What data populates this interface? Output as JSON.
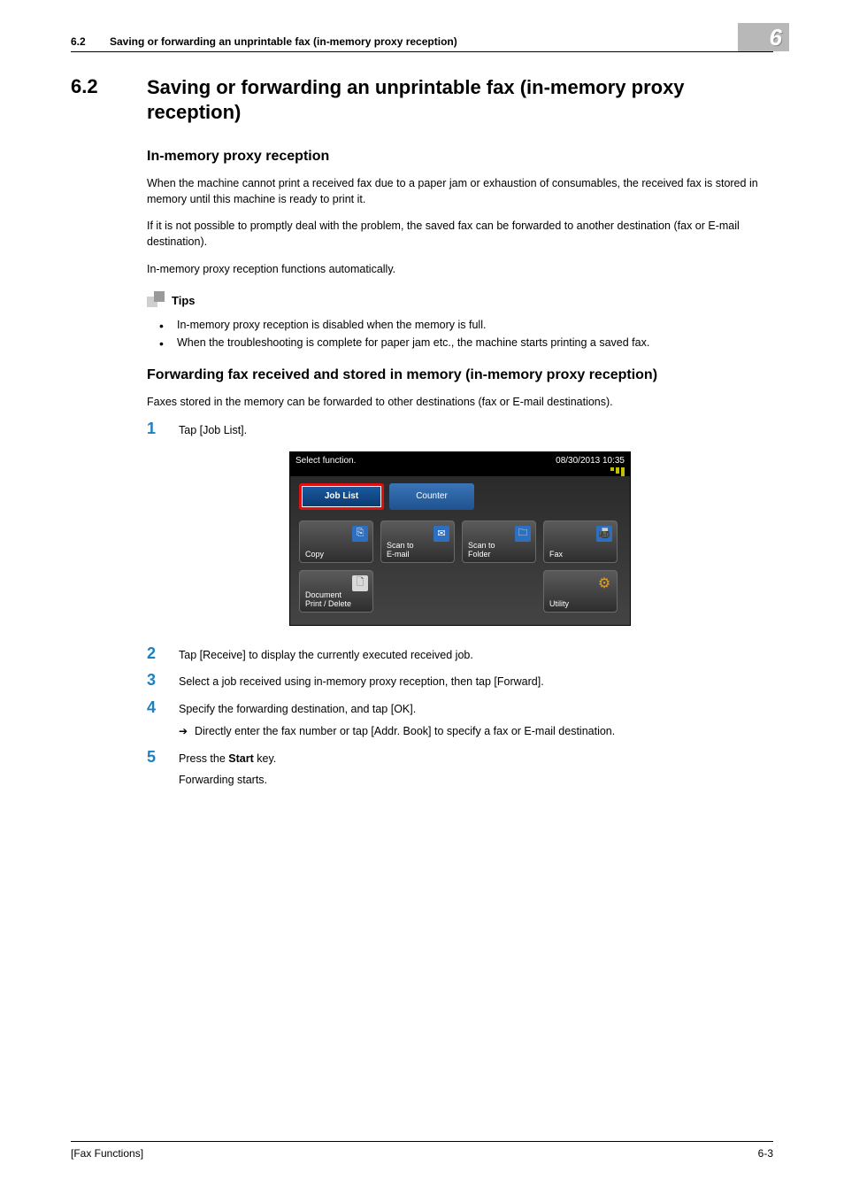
{
  "runhead": {
    "num": "6.2",
    "title": "Saving or forwarding an unprintable fax (in-memory proxy reception)"
  },
  "chapter_badge": "6",
  "h1": {
    "num": "6.2",
    "title": "Saving or forwarding an unprintable fax (in-memory proxy reception)"
  },
  "section1": {
    "heading": "In-memory proxy reception",
    "p1": "When the machine cannot print a received fax due to a paper jam or exhaustion of consumables, the received fax is stored in memory until this machine is ready to print it.",
    "p2": "If it is not possible to promptly deal with the problem, the saved fax can be forwarded to another destination (fax or E-mail destination).",
    "p3": "In-memory proxy reception functions automatically."
  },
  "tips": {
    "label": "Tips",
    "items": [
      "In-memory proxy reception is disabled when the memory is full.",
      "When the troubleshooting is complete for paper jam etc., the machine starts printing a saved fax."
    ]
  },
  "section2": {
    "heading": "Forwarding fax received and stored in memory (in-memory proxy reception)",
    "intro": "Faxes stored in the memory can be forwarded to other destinations (fax or E-mail destinations)."
  },
  "steps": [
    {
      "n": "1",
      "text": "Tap [Job List]."
    },
    {
      "n": "2",
      "text": "Tap [Receive] to display the currently executed received job."
    },
    {
      "n": "3",
      "text": "Select a job received using in-memory proxy reception, then tap [Forward]."
    },
    {
      "n": "4",
      "text": "Specify the forwarding destination, and tap [OK].",
      "sub": "Directly enter the fax number or tap [Addr. Book] to specify a fax or E-mail destination."
    },
    {
      "n": "5",
      "text_pre": "Press the ",
      "text_bold": "Start",
      "text_post": " key.",
      "tail": "Forwarding starts."
    }
  ],
  "screenshot": {
    "prompt": "Select function.",
    "datetime": "08/30/2013 10:35",
    "tabs": {
      "joblist": "Job List",
      "counter": "Counter"
    },
    "buttons": {
      "copy": "Copy",
      "scan_email": "Scan to\nE-mail",
      "scan_folder": "Scan to\nFolder",
      "fax": "Fax",
      "doc": "Document\nPrint / Delete",
      "utility": "Utility"
    }
  },
  "footer": {
    "left": "[Fax Functions]",
    "right": "6-3"
  }
}
